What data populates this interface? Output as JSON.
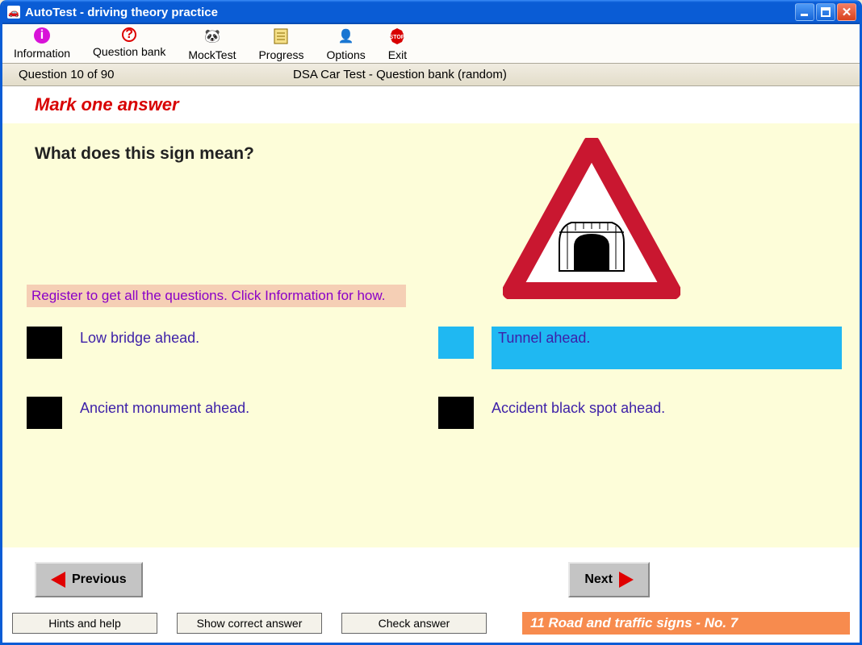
{
  "titlebar": {
    "title": "AutoTest - driving theory practice"
  },
  "menu": {
    "information": "Information",
    "question_bank": "Question bank",
    "mock_test": "MockTest",
    "progress": "Progress",
    "options": "Options",
    "exit": "Exit"
  },
  "status": {
    "question_count": "Question 10 of 90",
    "bank_label": "DSA Car Test - Question bank (random)"
  },
  "instruction": "Mark one answer",
  "question": {
    "text": "What does this sign mean?",
    "register_banner": "Register to get all the questions. Click Information for how."
  },
  "answers": {
    "a": "Low bridge ahead.",
    "b": "Tunnel ahead.",
    "c": "Ancient monument ahead.",
    "d": "Accident black spot ahead."
  },
  "nav": {
    "previous": "Previous",
    "next": "Next"
  },
  "bottom": {
    "hints": "Hints and help",
    "show_correct": "Show correct answer",
    "check": "Check answer",
    "category": "11  Road and traffic signs - No. 7"
  }
}
